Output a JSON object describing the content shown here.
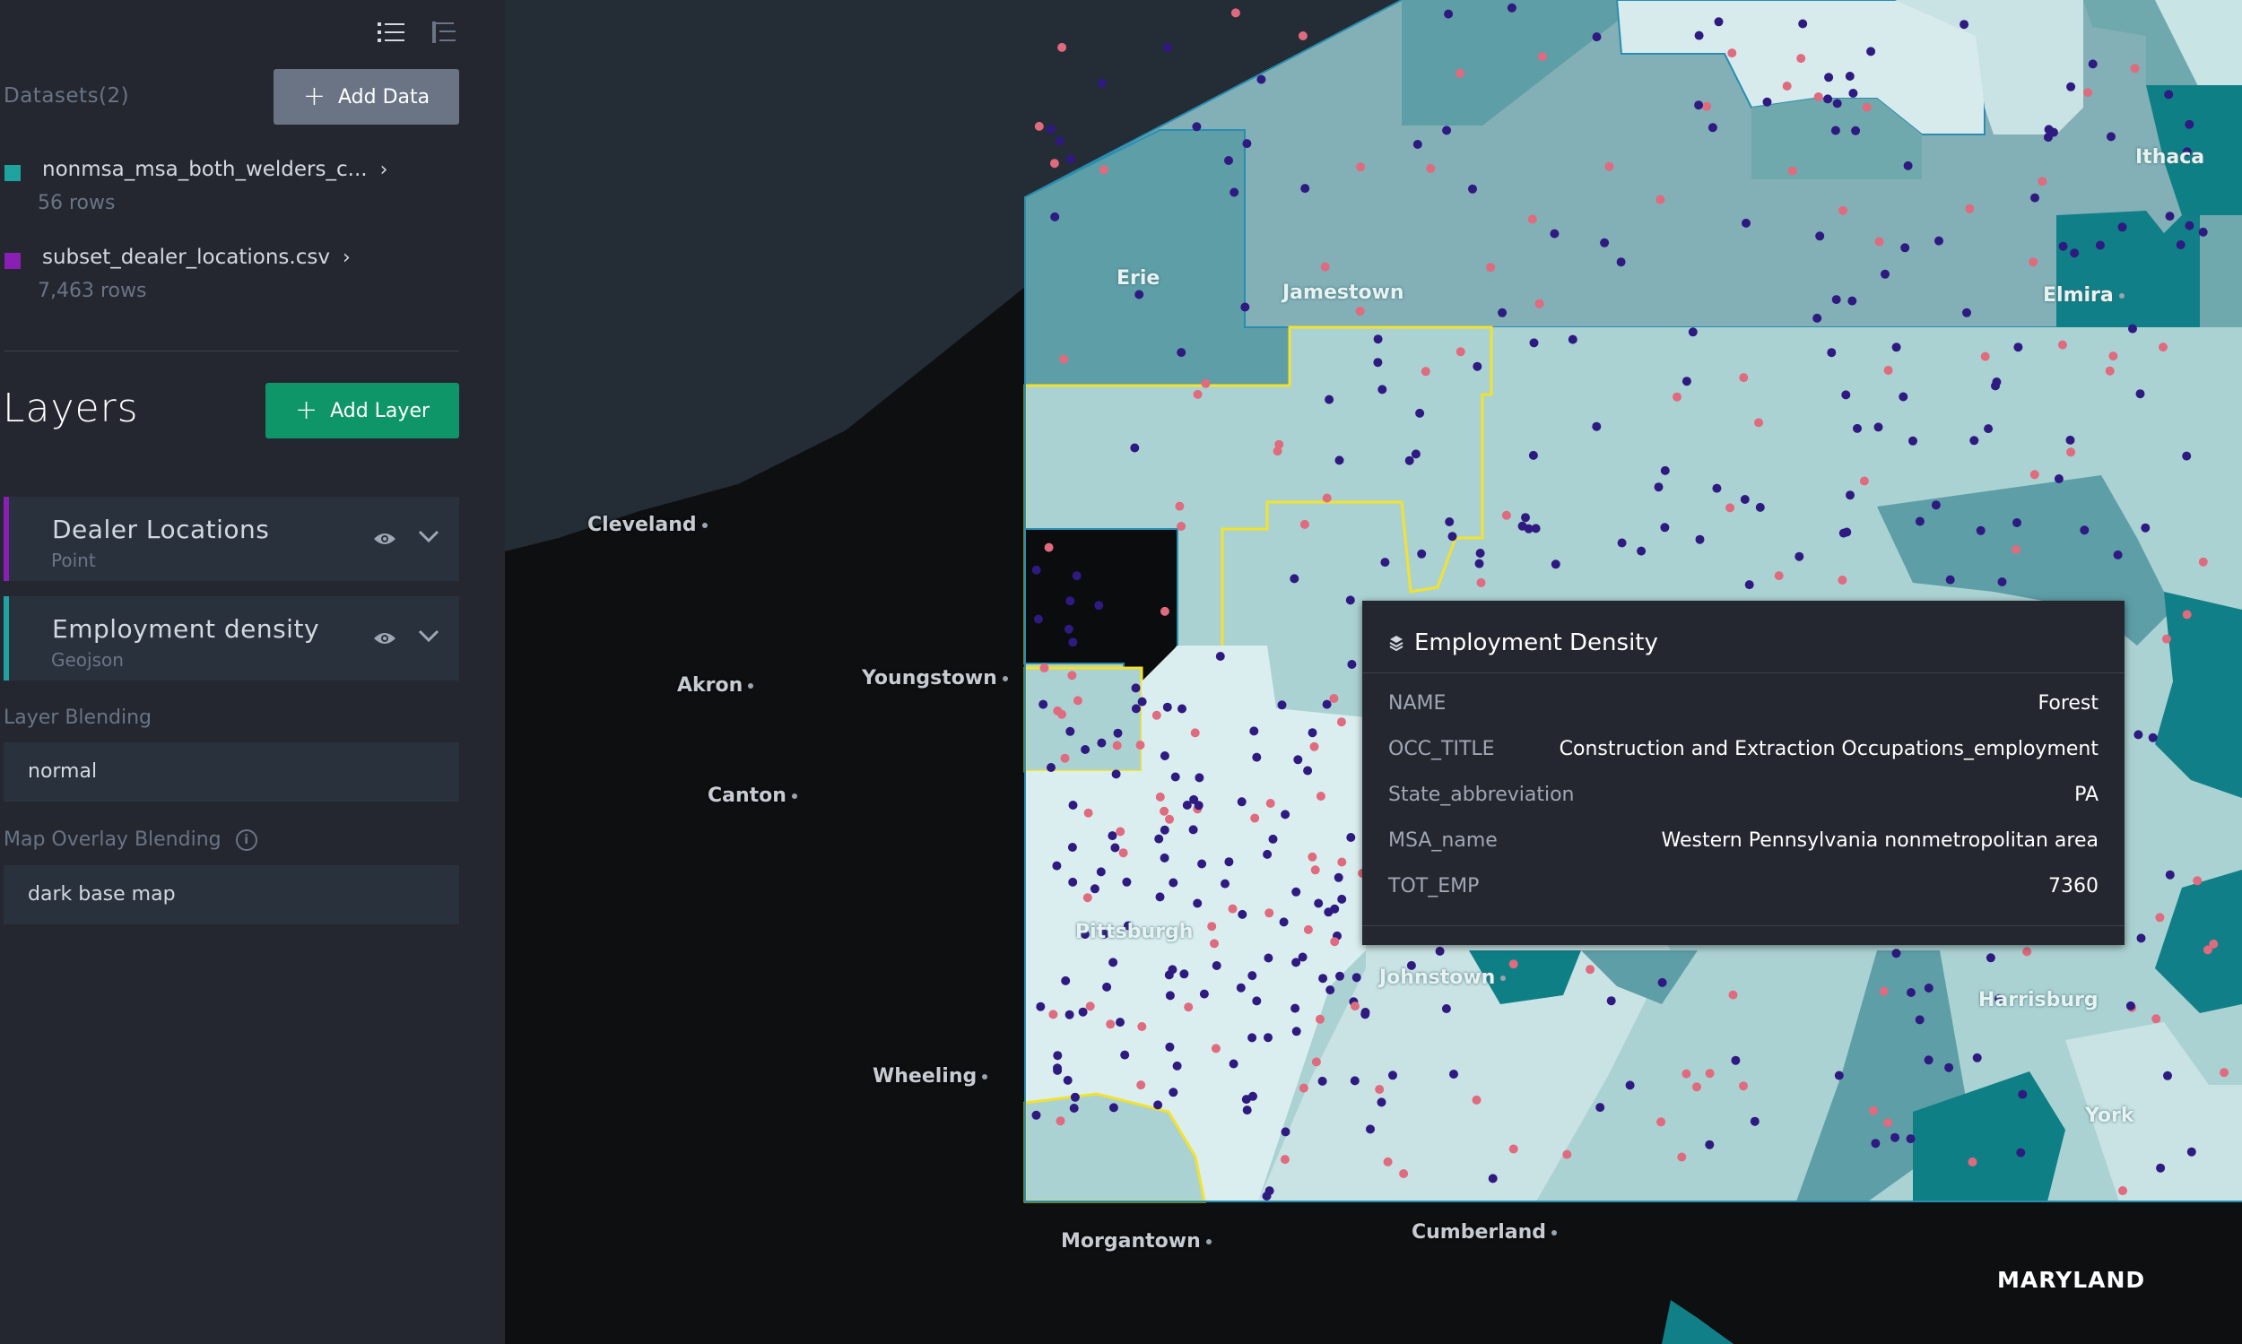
{
  "sidebar": {
    "datasets_header": "Datasets(2)",
    "add_data_label": "Add Data",
    "datasets": [
      {
        "name": "nonmsa_msa_both_welders_c...",
        "rows": "56 rows",
        "color": "#1fa3a0"
      },
      {
        "name": "subset_dealer_locations.csv",
        "rows": "7,463 rows",
        "color": "#8a1fb4"
      }
    ],
    "layers_title": "Layers",
    "add_layer_label": "Add Layer",
    "layers": [
      {
        "name": "Dealer Locations",
        "type": "Point",
        "color": "#8a1fb4"
      },
      {
        "name": "Employment density",
        "type": "Geojson",
        "color": "#1fa3a0"
      }
    ],
    "layer_blending_label": "Layer Blending",
    "layer_blending_value": "normal",
    "map_overlay_label": "Map Overlay Blending",
    "map_overlay_value": "dark base map"
  },
  "map": {
    "cities": {
      "cleveland": "Cleveland",
      "akron": "Akron",
      "youngstown": "Youngstown",
      "canton": "Canton",
      "wheeling": "Wheeling",
      "morgantown": "Morgantown",
      "cumberland": "Cumberland",
      "erie": "Erie",
      "jamestown": "Jamestown",
      "elmira": "Elmira",
      "ithaca": "Ithaca",
      "pittsburgh": "Pittsburgh",
      "johnstown": "Johnstown",
      "harrisburg": "Harrisburg",
      "york": "York"
    },
    "state_label": "MARYLAND"
  },
  "tooltip": {
    "title": "Employment Density",
    "rows": [
      {
        "key": "NAME",
        "value": "Forest"
      },
      {
        "key": "OCC_TITLE",
        "value": "Construction and Extraction Occupations_employment"
      },
      {
        "key": "State_abbreviation",
        "value": "PA"
      },
      {
        "key": "MSA_name",
        "value": "Western Pennsylvania nonmetropolitan area"
      },
      {
        "key": "TOT_EMP",
        "value": "7360"
      }
    ]
  },
  "colors": {
    "accent_green": "#0f9668",
    "point_dark": "#2e1a80",
    "point_pink": "#e06a7e",
    "selection_outline": "#f2e22e"
  }
}
